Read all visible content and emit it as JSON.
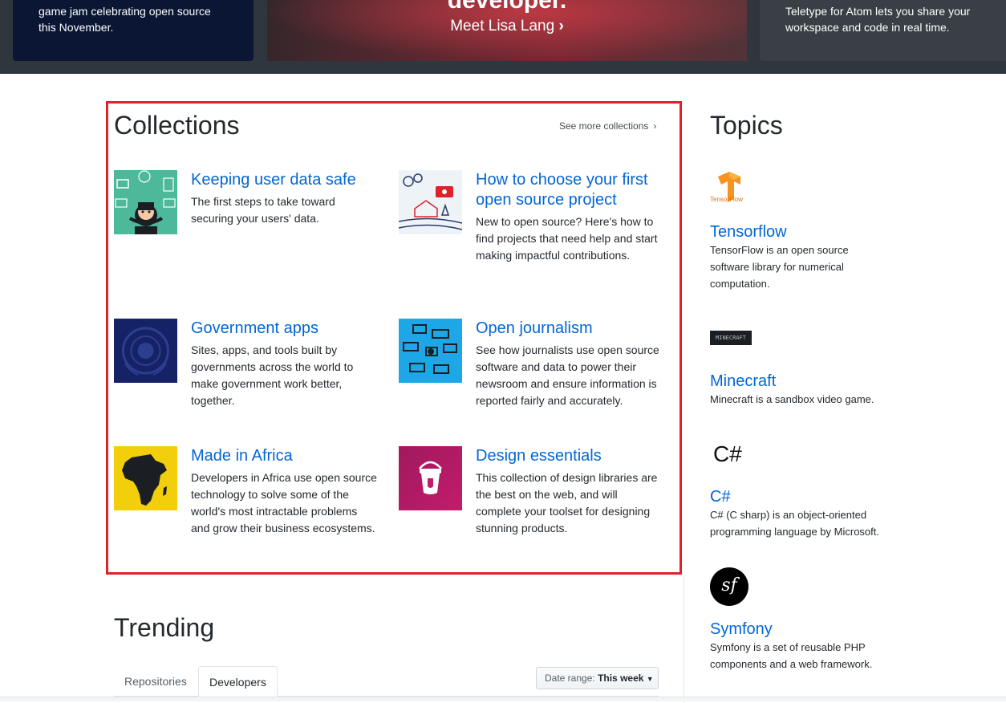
{
  "banner": {
    "left_text": "game jam celebrating open source this November.",
    "mid_headline": "developer.",
    "mid_cta": "Meet Lisa Lang",
    "right_text": "Teletype for Atom lets you share your workspace and code in real time."
  },
  "collections": {
    "title": "Collections",
    "see_more": "See more collections",
    "items": [
      {
        "title": "Keeping user data safe",
        "desc": "The first steps to take toward securing your users' data."
      },
      {
        "title": "How to choose your first open source project",
        "desc": "New to open source? Here's how to find projects that need help and start making impactful contributions."
      },
      {
        "title": "Government apps",
        "desc": "Sites, apps, and tools built by governments across the world to make government work better, together."
      },
      {
        "title": "Open journalism",
        "desc": "See how journalists use open source software and data to power their newsroom and ensure information is reported fairly and accurately."
      },
      {
        "title": "Made in Africa",
        "desc": "Developers in Africa use open source technology to solve some of the world's most intractable problems and grow their business ecosystems."
      },
      {
        "title": "Design essentials",
        "desc": "This collection of design libraries are the best on the web, and will complete your toolset for designing stunning products."
      }
    ]
  },
  "topics": {
    "title": "Topics",
    "items": [
      {
        "title": "Tensorflow",
        "desc": "TensorFlow is an open source software library for numerical computation.",
        "logo_text": "TensorFlow"
      },
      {
        "title": "Minecraft",
        "desc": "Minecraft is a sandbox video game.",
        "logo_text": "MINECRAFT"
      },
      {
        "title": "C#",
        "desc": "C# (C sharp) is an object-oriented programming language by Microsoft.",
        "logo_text": "C#"
      },
      {
        "title": "Symfony",
        "desc": "Symfony is a set of reusable PHP components and a web framework.",
        "logo_text": "sf"
      }
    ]
  },
  "trending": {
    "title": "Trending",
    "tabs": [
      "Repositories",
      "Developers"
    ],
    "active_tab": "Developers",
    "date_range_label": "Date range:",
    "date_range_value": "This week"
  }
}
